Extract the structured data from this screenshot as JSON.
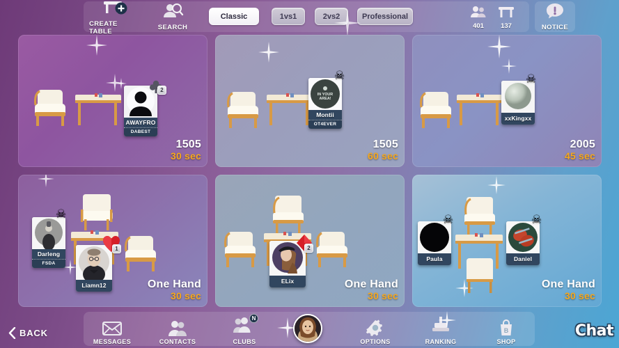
{
  "topbar": {
    "create_table": {
      "label": "CREATE TABLE",
      "icon": "table-plus-icon"
    },
    "search": {
      "label": "SEARCH",
      "icon": "search-person-icon"
    },
    "filters": [
      {
        "label": "Classic",
        "active": true
      },
      {
        "label": "1vs1",
        "active": false
      },
      {
        "label": "2vs2",
        "active": false
      },
      {
        "label": "Professional",
        "active": false
      }
    ],
    "counters": [
      {
        "icon": "people-icon",
        "value": "401"
      },
      {
        "icon": "table-icon",
        "value": "137"
      }
    ],
    "notice": {
      "label": "NOTICE",
      "icon": "notice-bubble-icon"
    }
  },
  "tables": [
    {
      "id": "table-1",
      "mode": "1505",
      "time": "30 sec",
      "bg": "purple",
      "seats": 2,
      "players": [
        {
          "name": "AWAYFRO",
          "club": "DABEST",
          "badge": "2",
          "suit": "club",
          "avatar_kind": "silhouette",
          "has_skull": false
        }
      ]
    },
    {
      "id": "table-2",
      "mode": "1505",
      "time": "60 sec",
      "bg": "lavender",
      "seats": 2,
      "players": [
        {
          "name": "Montii",
          "club": "OT4EVER",
          "badge": "",
          "suit": "",
          "avatar_kind": "dark-circle",
          "avatar_text": "IN YOUR AREA!",
          "has_skull": true
        }
      ]
    },
    {
      "id": "table-3",
      "mode": "2005",
      "time": "45 sec",
      "bg": "blue-violet",
      "seats": 2,
      "players": [
        {
          "name": "xxKingxx",
          "club": "",
          "badge": "",
          "suit": "",
          "avatar_kind": "sphere",
          "has_skull": true
        }
      ]
    },
    {
      "id": "table-4",
      "mode": "One Hand",
      "time": "30 sec",
      "bg": "purple-2",
      "seats": 4,
      "players": [
        {
          "name": "Darleng",
          "club": "FSDA",
          "badge": "",
          "suit": "",
          "avatar_kind": "photo-gray",
          "has_skull": true
        },
        {
          "name": "Liamn12",
          "club": "",
          "badge": "1",
          "suit": "heart",
          "avatar_kind": "photo-man",
          "has_skull": false
        }
      ]
    },
    {
      "id": "table-5",
      "mode": "One Hand",
      "time": "30 sec",
      "bg": "steel-blue",
      "seats": 4,
      "players": [
        {
          "name": "ELix",
          "club": "",
          "badge": "2",
          "suit": "diamond",
          "avatar_kind": "photo-woman",
          "has_skull": false
        }
      ]
    },
    {
      "id": "table-6",
      "mode": "One Hand",
      "time": "30 sec",
      "bg": "sky-blue",
      "seats": 4,
      "players": [
        {
          "name": "Paula",
          "club": "",
          "badge": "",
          "suit": "",
          "avatar_kind": "black-circle",
          "has_skull": true
        },
        {
          "name": "Daniel",
          "club": "",
          "badge": "",
          "suit": "",
          "avatar_kind": "photo-red",
          "has_skull": true
        }
      ]
    }
  ],
  "bottombar": {
    "back": {
      "label": "BACK",
      "icon": "chevron-left-icon"
    },
    "items": [
      {
        "label": "MESSAGES",
        "icon": "envelope-icon",
        "badge": ""
      },
      {
        "label": "CONTACTS",
        "icon": "people-icon",
        "badge": ""
      },
      {
        "label": "CLUBS",
        "icon": "people-group-icon",
        "badge": "N"
      },
      {
        "label": "OPTIONS",
        "icon": "gear-icon",
        "badge": ""
      },
      {
        "label": "RANKING",
        "icon": "podium-icon",
        "badge": ""
      },
      {
        "label": "SHOP",
        "icon": "shopping-bag-icon",
        "badge": ""
      }
    ],
    "profile_avatar": {
      "name": "profile-avatar"
    },
    "chat": {
      "label": "Chat"
    }
  },
  "colors": {
    "accent_time": "#f6a81d",
    "card_name_bg": "#31465f",
    "filter_active_bg": "#ffffff"
  }
}
